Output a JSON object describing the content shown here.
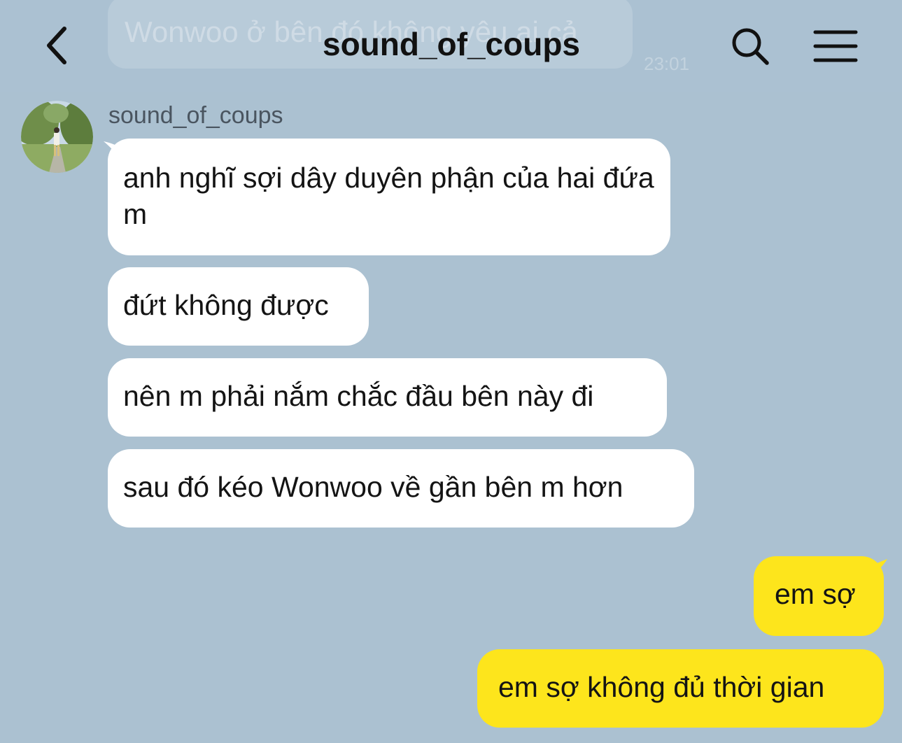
{
  "header": {
    "title": "sound_of_coups",
    "back_icon": "chevron-left-icon",
    "search_icon": "search-icon",
    "menu_icon": "hamburger-menu-icon",
    "pinned_preview": {
      "text": "Wonwoo ở bên đó không yêu ai cả",
      "time": "23:01"
    }
  },
  "chat": {
    "sender": {
      "name": "sound_of_coups",
      "avatar_icon": "profile-photo-avatar"
    },
    "incoming": [
      {
        "text": "anh nghĩ sợi dây duyên phận của hai đứa m"
      },
      {
        "text": "đứt không được"
      },
      {
        "text": "nên m phải nắm chắc đầu bên này đi"
      },
      {
        "text": "sau đó kéo Wonwoo về gần bên m hơn"
      }
    ],
    "outgoing": [
      {
        "text": "em sợ"
      },
      {
        "text": "em sợ không đủ thời gian"
      }
    ]
  },
  "colors": {
    "background": "#abc1d1",
    "incoming_bubble": "#ffffff",
    "outgoing_bubble": "#fde51c",
    "text": "#141414"
  }
}
